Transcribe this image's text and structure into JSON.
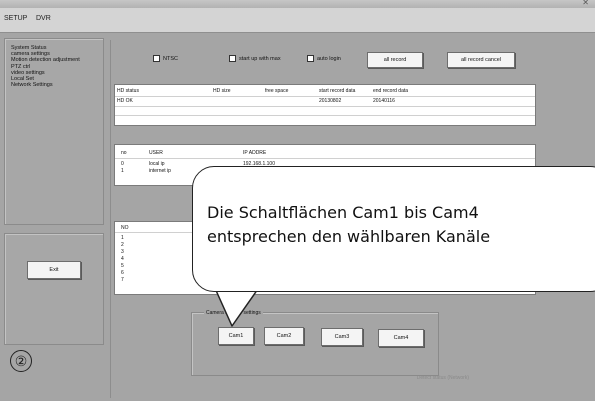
{
  "menubar": {
    "items": [
      "SETUP",
      "DVR"
    ]
  },
  "sidebar": {
    "items": [
      "System Status",
      "camera settings",
      "Motion detection adjustment",
      "PTZ ctrl",
      "video settings",
      "Local Set",
      "Network Settings"
    ],
    "exit_label": "Exit"
  },
  "options": {
    "ntsc_label": "NTSC",
    "startup_label": "start up with max",
    "autologin_label": "auto login",
    "all_record_label": "all record",
    "all_record_cancel_label": "all record cancel"
  },
  "hd_table": {
    "headers": [
      "HD status",
      "HD size",
      "free space",
      "start record data",
      "end record data"
    ],
    "row": [
      "HD OK",
      "",
      "",
      "20130802",
      "20140116"
    ]
  },
  "user_table": {
    "headers": [
      "no",
      "USER",
      "IP ADDRE"
    ],
    "rows": [
      [
        "0",
        "local ip",
        "192.168.1.100"
      ],
      [
        "1",
        "internet ip",
        ""
      ]
    ]
  },
  "channel_table": {
    "header": "NO",
    "rows": [
      "1",
      "2",
      "3",
      "4",
      "5",
      "6",
      "7"
    ]
  },
  "camera_group": {
    "label": "Camera number settings",
    "buttons": [
      "Cam1",
      "Cam2",
      "Cam3",
      "Cam4"
    ]
  },
  "status_text": "Detect status (Network)",
  "callout": {
    "line1": "Die Schaltflächen Cam1 bis Cam4",
    "line2": "entsprechen den wählbaren Kanäle"
  },
  "step_number": "②"
}
